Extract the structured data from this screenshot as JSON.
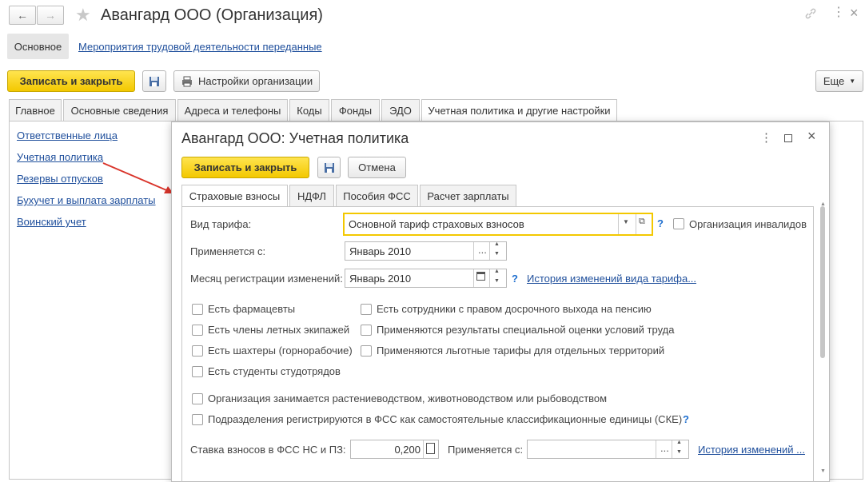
{
  "window": {
    "title": "Авангард ООО (Организация)"
  },
  "nav": {
    "back": "←",
    "forward": "→"
  },
  "section_tabs": {
    "main": "Основное",
    "activities": "Мероприятия трудовой деятельности переданные"
  },
  "toolbar": {
    "save_close": "Записать и закрыть",
    "settings": "Настройки организации",
    "more": "Еще"
  },
  "tabs": [
    "Главное",
    "Основные сведения",
    "Адреса и телефоны",
    "Коды",
    "Фонды",
    "ЭДО",
    "Учетная политика и другие настройки"
  ],
  "sidebar": [
    "Ответственные лица",
    "Учетная политика",
    "Резервы отпусков",
    "Бухучет и выплата зарплаты",
    "Воинский учет"
  ],
  "dialog": {
    "title": "Авангард ООО: Учетная политика",
    "save_close": "Записать и закрыть",
    "cancel": "Отмена",
    "tabs": [
      "Страховые взносы",
      "НДФЛ",
      "Пособия ФСС",
      "Расчет зарплаты"
    ],
    "tariff_label": "Вид тарифа:",
    "tariff_value": "Основной тариф страховых взносов",
    "disabled_org": "Организация инвалидов",
    "applies_label": "Применяется с:",
    "applies_value": "Январь 2010",
    "reg_month_label": "Месяц регистрации изменений:",
    "reg_month_value": "Январь 2010",
    "history_link": "История изменений вида тарифа...",
    "checks_left": [
      "Есть фармацевты",
      "Есть члены летных экипажей",
      "Есть шахтеры (горнорабочие)",
      "Есть студенты студотрядов"
    ],
    "checks_right": [
      "Есть сотрудники с правом досрочного выхода на пенсию",
      "Применяются результаты специальной оценки условий труда",
      "Применяются льготные тарифы для отдельных территорий"
    ],
    "check_agri": "Организация занимается растениеводством, животноводством или рыбоводством",
    "check_fss": "Подразделения регистрируются в ФСС как самостоятельные классификационные единицы (СКЕ)",
    "rate_label": "Ставка взносов в ФСС НС и ПЗ:",
    "rate_value": "0,200",
    "rate_applies_label": "Применяется с:",
    "rate_history": "История изменений ...",
    "question": "?"
  },
  "colors": {
    "accent_yellow": "#f3c800",
    "link": "#1f4f9c",
    "arrow": "#d9342b"
  }
}
